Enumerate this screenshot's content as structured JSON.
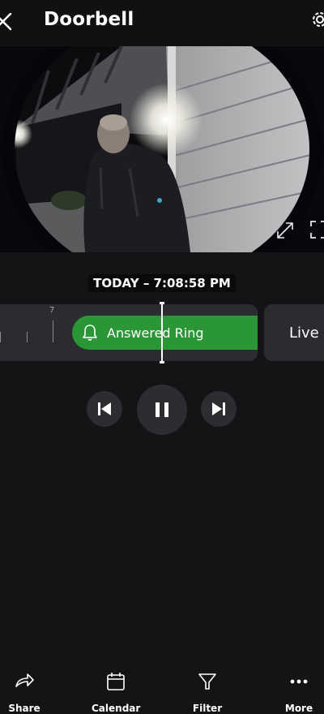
{
  "header": {
    "title": "Doorbell",
    "close_icon": "close-icon",
    "settings_icon": "gear-icon"
  },
  "video": {
    "description_icon_expand": "expand-icon",
    "description_icon_fullscreen": "fullscreen-icon"
  },
  "timestamp": "TODAY – 7:08:58 PM",
  "timeline": {
    "tick_label": "7",
    "event_label": "Answered Ring",
    "event_icon": "bell-icon",
    "event_color": "#2a9636",
    "live_label": "Live"
  },
  "controls": {
    "previous_icon": "skip-previous-icon",
    "pause_icon": "pause-icon",
    "next_icon": "skip-next-icon"
  },
  "bottom_bar": [
    {
      "icon": "share-icon",
      "label": "Share"
    },
    {
      "icon": "calendar-icon",
      "label": "Calendar"
    },
    {
      "icon": "filter-icon",
      "label": "Filter"
    },
    {
      "icon": "more-icon",
      "label": "More"
    }
  ]
}
